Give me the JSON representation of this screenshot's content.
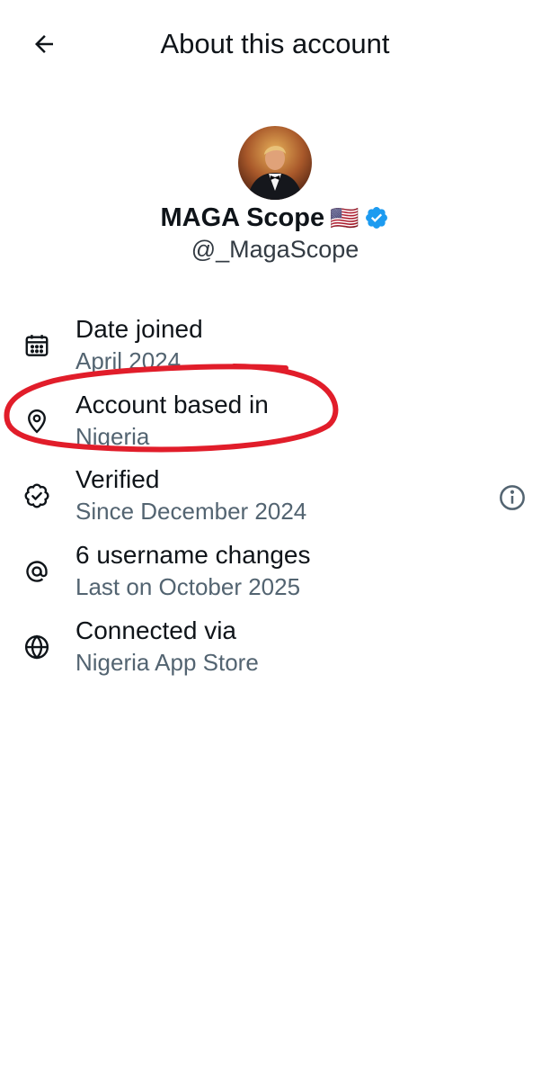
{
  "header": {
    "title": "About this account",
    "back_icon": "arrow-left-icon"
  },
  "profile": {
    "display_name": "MAGA Scope",
    "flag": "🇺🇸",
    "verified_icon": "verified-badge-icon",
    "handle": "@_MagaScope"
  },
  "rows": [
    {
      "icon": "calendar-icon",
      "title": "Date joined",
      "subtitle": "April 2024"
    },
    {
      "icon": "location-pin-icon",
      "title": "Account based in",
      "subtitle": "Nigeria"
    },
    {
      "icon": "verified-outline-icon",
      "title": "Verified",
      "subtitle": "Since December 2024",
      "action_icon": "info-icon"
    },
    {
      "icon": "at-sign-icon",
      "title": "6 username changes",
      "subtitle": "Last on October 2025"
    },
    {
      "icon": "globe-icon",
      "title": "Connected via",
      "subtitle": "Nigeria App Store"
    }
  ],
  "colors": {
    "text_primary": "#0f1419",
    "text_secondary": "#536471",
    "verified_blue": "#1d9bf0",
    "highlight_red": "#e11d2a"
  }
}
